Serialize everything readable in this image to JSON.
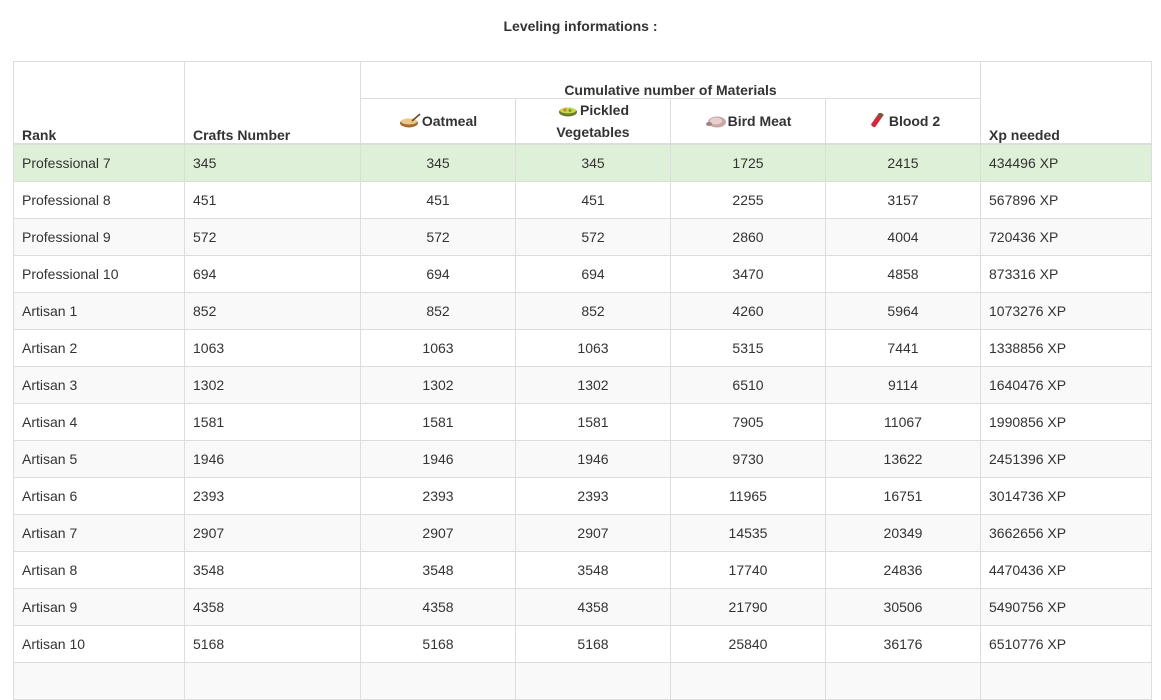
{
  "title": "Leveling informations :",
  "headers": {
    "rank": "Rank",
    "crafts": "Crafts Number",
    "group": "Cumulative number of Materials",
    "xp": "Xp needed"
  },
  "materials": [
    {
      "name": "Oatmeal",
      "icon": "oatmeal-bowl-icon"
    },
    {
      "name_line1": "Pickled",
      "name_line2": "Vegetables",
      "icon": "pickled-vegetables-icon"
    },
    {
      "name": "Bird Meat",
      "icon": "bird-meat-icon"
    },
    {
      "name": "Blood 2",
      "icon": "blood-vial-icon"
    }
  ],
  "colors": {
    "highlight": "#dff0d8",
    "stripe": "#f9f9f9",
    "border": "#dddddd"
  },
  "rows": [
    {
      "rank": "Professional 7",
      "crafts": "345",
      "oatmeal": "345",
      "pickled": "345",
      "bird": "1725",
      "blood": "2415",
      "xp": "434496 XP"
    },
    {
      "rank": "Professional 8",
      "crafts": "451",
      "oatmeal": "451",
      "pickled": "451",
      "bird": "2255",
      "blood": "3157",
      "xp": "567896 XP"
    },
    {
      "rank": "Professional 9",
      "crafts": "572",
      "oatmeal": "572",
      "pickled": "572",
      "bird": "2860",
      "blood": "4004",
      "xp": "720436 XP"
    },
    {
      "rank": "Professional 10",
      "crafts": "694",
      "oatmeal": "694",
      "pickled": "694",
      "bird": "3470",
      "blood": "4858",
      "xp": "873316 XP"
    },
    {
      "rank": "Artisan 1",
      "crafts": "852",
      "oatmeal": "852",
      "pickled": "852",
      "bird": "4260",
      "blood": "5964",
      "xp": "1073276 XP"
    },
    {
      "rank": "Artisan 2",
      "crafts": "1063",
      "oatmeal": "1063",
      "pickled": "1063",
      "bird": "5315",
      "blood": "7441",
      "xp": "1338856 XP"
    },
    {
      "rank": "Artisan 3",
      "crafts": "1302",
      "oatmeal": "1302",
      "pickled": "1302",
      "bird": "6510",
      "blood": "9114",
      "xp": "1640476 XP"
    },
    {
      "rank": "Artisan 4",
      "crafts": "1581",
      "oatmeal": "1581",
      "pickled": "1581",
      "bird": "7905",
      "blood": "11067",
      "xp": "1990856 XP"
    },
    {
      "rank": "Artisan 5",
      "crafts": "1946",
      "oatmeal": "1946",
      "pickled": "1946",
      "bird": "9730",
      "blood": "13622",
      "xp": "2451396 XP"
    },
    {
      "rank": "Artisan 6",
      "crafts": "2393",
      "oatmeal": "2393",
      "pickled": "2393",
      "bird": "11965",
      "blood": "16751",
      "xp": "3014736 XP"
    },
    {
      "rank": "Artisan 7",
      "crafts": "2907",
      "oatmeal": "2907",
      "pickled": "2907",
      "bird": "14535",
      "blood": "20349",
      "xp": "3662656 XP"
    },
    {
      "rank": "Artisan 8",
      "crafts": "3548",
      "oatmeal": "3548",
      "pickled": "3548",
      "bird": "17740",
      "blood": "24836",
      "xp": "4470436 XP"
    },
    {
      "rank": "Artisan 9",
      "crafts": "4358",
      "oatmeal": "4358",
      "pickled": "4358",
      "bird": "21790",
      "blood": "30506",
      "xp": "5490756 XP"
    },
    {
      "rank": "Artisan 10",
      "crafts": "5168",
      "oatmeal": "5168",
      "pickled": "5168",
      "bird": "25840",
      "blood": "36176",
      "xp": "6510776 XP"
    },
    {
      "rank": "",
      "crafts": "",
      "oatmeal": "",
      "pickled": "",
      "bird": "",
      "blood": "",
      "xp": ""
    }
  ]
}
